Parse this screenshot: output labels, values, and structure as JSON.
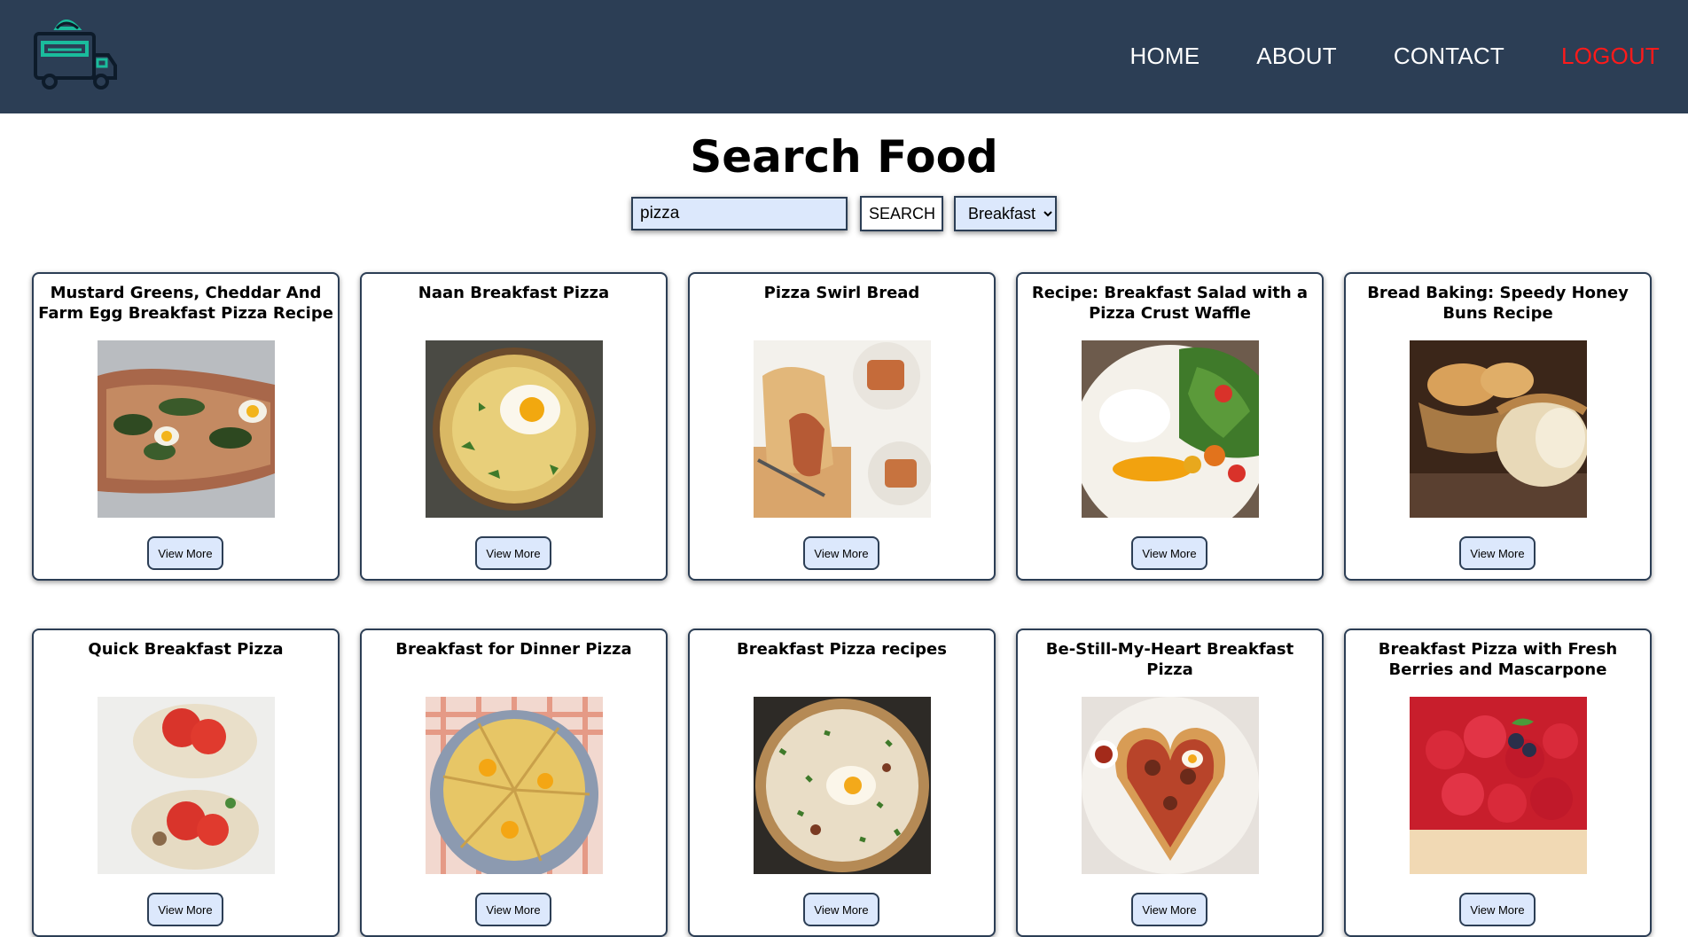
{
  "nav": {
    "links": [
      "HOME",
      "ABOUT",
      "CONTACT",
      "LOGOUT"
    ]
  },
  "search": {
    "title": "Search Food",
    "query": "pizza",
    "button_label": "SEARCH",
    "category": "Breakfast"
  },
  "colors": {
    "navbar": "#2c3e55",
    "accent": "#1abc9c",
    "logout": "#ff1a1a",
    "input_bg": "#dce8fc"
  },
  "cards": [
    {
      "title": "Mustard Greens, Cheddar And Farm Egg Breakfast Pizza Recipe",
      "button": "View More",
      "image": "flatbread-with-greens-and-eggs"
    },
    {
      "title": "Naan Breakfast Pizza",
      "button": "View More",
      "image": "naan-pizza-with-egg"
    },
    {
      "title": "Pizza Swirl Bread",
      "button": "View More",
      "image": "swirl-bread-slices"
    },
    {
      "title": "Recipe: Breakfast Salad with a Pizza Crust Waffle",
      "button": "View More",
      "image": "salad-plate-with-egg"
    },
    {
      "title": "Bread Baking: Speedy Honey Buns Recipe",
      "button": "View More",
      "image": "honey-buns-basket"
    },
    {
      "title": "Quick Breakfast Pizza",
      "button": "View More",
      "image": "mini-pizzas-with-tomato"
    },
    {
      "title": "Breakfast for Dinner Pizza",
      "button": "View More",
      "image": "sliced-egg-pizza"
    },
    {
      "title": "Breakfast Pizza recipes",
      "button": "View More",
      "image": "herb-egg-pizza"
    },
    {
      "title": "Be-Still-My-Heart Breakfast Pizza",
      "button": "View More",
      "image": "heart-shaped-pizza"
    },
    {
      "title": "Breakfast Pizza with Fresh Berries and Mascarpone",
      "button": "View More",
      "image": "berry-tart"
    }
  ]
}
